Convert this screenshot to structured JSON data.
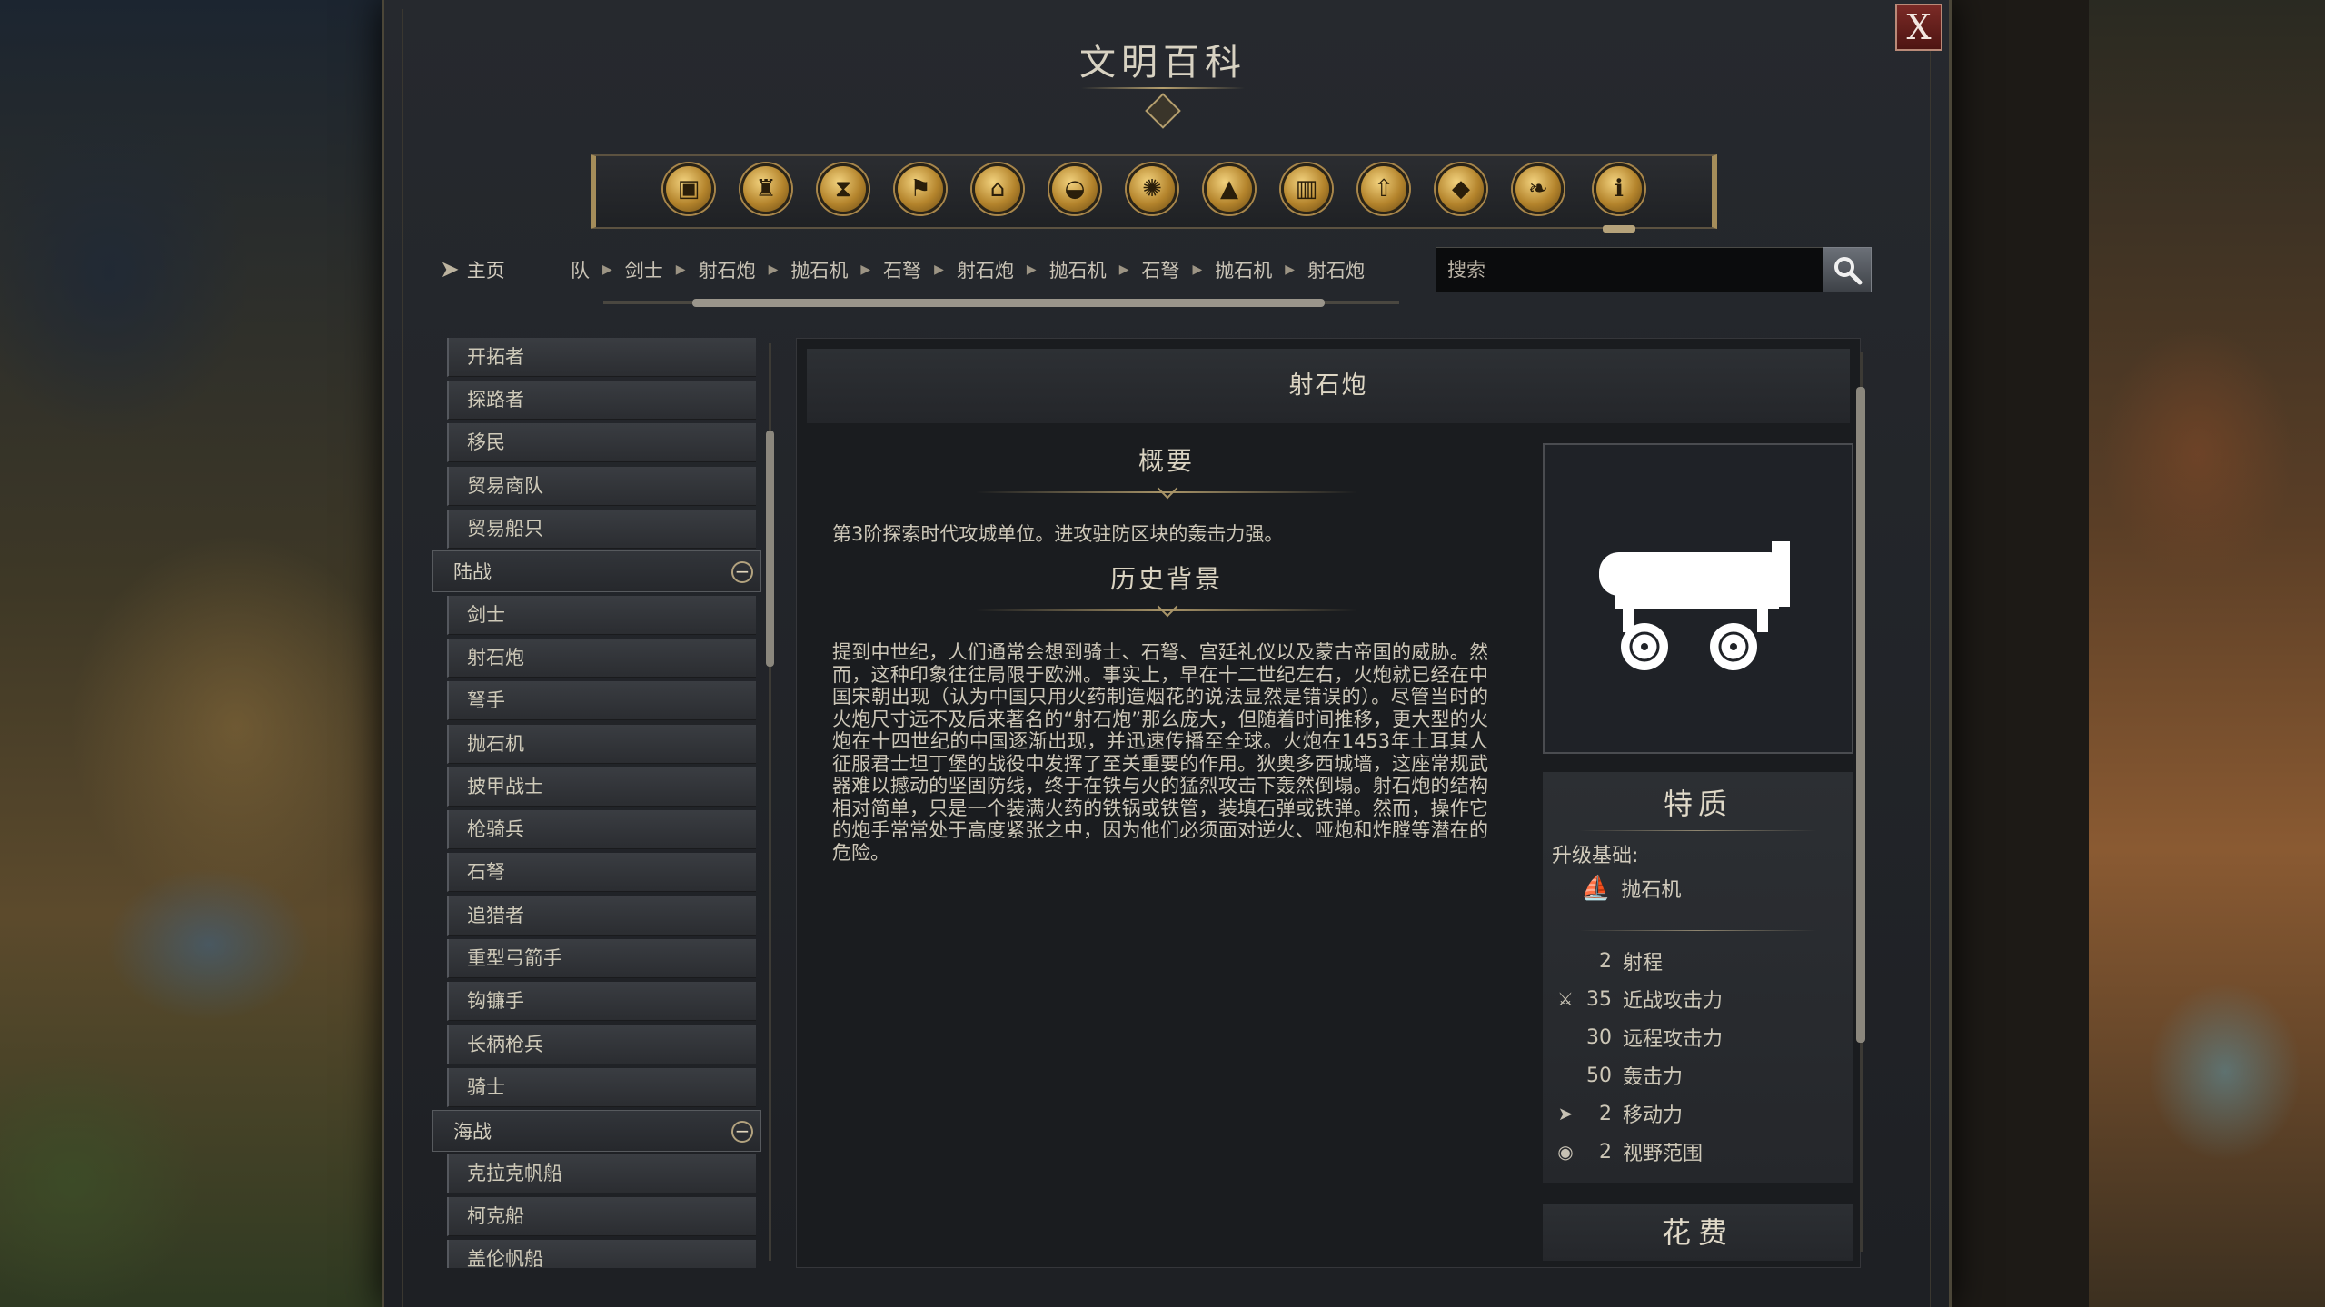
{
  "window": {
    "title": "文明百科",
    "close_label": "X"
  },
  "categories": [
    {
      "icon": "civilization-icon"
    },
    {
      "icon": "leader-icon"
    },
    {
      "icon": "age-hourglass-icon"
    },
    {
      "icon": "flag-icon"
    },
    {
      "icon": "building-icon"
    },
    {
      "icon": "resource-icon"
    },
    {
      "icon": "wonder-icon"
    },
    {
      "icon": "terrain-icon"
    },
    {
      "icon": "settlement-icon"
    },
    {
      "icon": "unit-upgrade-icon"
    },
    {
      "icon": "diamond-icon"
    },
    {
      "icon": "bird-icon"
    },
    {
      "icon": "info-icon"
    }
  ],
  "nav": {
    "home_label": "主页",
    "breadcrumbs": [
      "队",
      "剑士",
      "射石炮",
      "抛石机",
      "石弩",
      "射石炮",
      "抛石机",
      "石弩",
      "抛石机",
      "射石炮"
    ],
    "search_placeholder": "搜索"
  },
  "list": {
    "items_top": [
      "开拓者",
      "探路者",
      "移民",
      "贸易商队",
      "贸易船只"
    ],
    "group_land": "陆战",
    "items_land": [
      "剑士",
      "射石炮",
      "弩手",
      "抛石机",
      "披甲战士",
      "枪骑兵",
      "石弩",
      "追猎者",
      "重型弓箭手",
      "钩镰手",
      "长柄枪兵",
      "骑士"
    ],
    "group_naval": "海战",
    "items_naval": [
      "克拉克帆船",
      "柯克船",
      "盖伦帆船"
    ]
  },
  "detail": {
    "title": "射石炮",
    "summary_heading": "概要",
    "summary_text": "第3阶探索时代攻城单位。进攻驻防区块的轰击力强。",
    "history_heading": "历史背景",
    "history_text": "提到中世纪，人们通常会想到骑士、石弩、宫廷礼仪以及蒙古帝国的威胁。然而，这种印象往往局限于欧洲。事实上，早在十二世纪左右，火炮就已经在中国宋朝出现（认为中国只用火药制造烟花的说法显然是错误的）。尽管当时的火炮尺寸远不及后来著名的“射石炮”那么庞大，但随着时间推移，更大型的火炮在十四世纪的中国逐渐出现，并迅速传播至全球。火炮在1453年土耳其人征服君士坦丁堡的战役中发挥了至关重要的作用。狄奥多西城墙，这座常规武器难以撼动的坚固防线，终于在铁与火的猛烈攻击下轰然倒塌。射石炮的结构相对简单，只是一个装满火药的铁锅或铁管，装填石弹或铁弹。然而，操作它的炮手常常处于高度紧张之中，因为他们必须面对逆火、哑炮和炸膛等潜在的危险。",
    "traits_heading": "特质",
    "upgrade_label": "升级基础:",
    "upgrade_from": "抛石机",
    "stats": [
      {
        "icon": "",
        "value": "2",
        "label": "射程"
      },
      {
        "icon": "melee-sword-icon",
        "value": "35",
        "label": "近战攻击力"
      },
      {
        "icon": "",
        "value": "30",
        "label": "远程攻击力"
      },
      {
        "icon": "",
        "value": "50",
        "label": "轰击力"
      },
      {
        "icon": "movement-arrow-icon",
        "value": "2",
        "label": "移动力"
      },
      {
        "icon": "sight-eye-icon",
        "value": "2",
        "label": "视野范围"
      }
    ],
    "cost_heading": "花费"
  },
  "colors": {
    "accent_gold": "#b59f6e",
    "close_red": "#7a2a26",
    "panel_bg": "#1a1c1f"
  }
}
